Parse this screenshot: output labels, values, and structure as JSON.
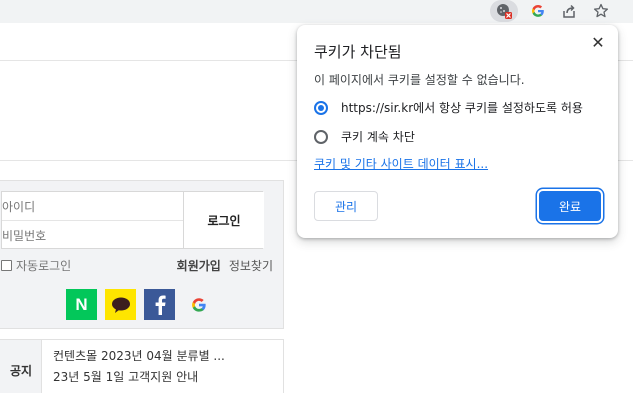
{
  "toolbar": {
    "icons": [
      "cookie-blocked-icon",
      "google-icon",
      "share-icon",
      "star-icon"
    ]
  },
  "login": {
    "id_placeholder": "아이디",
    "pw_placeholder": "비밀번호",
    "login_label": "로그인",
    "auto_login_label": "자동로그인",
    "join_label": "회원가입",
    "find_label": "정보찾기",
    "social": {
      "naver_label": "N",
      "colors": {
        "naver": "#03c75a",
        "kakao": "#fee500",
        "facebook": "#3b5998"
      }
    }
  },
  "notice": {
    "label": "공지",
    "items": [
      "컨텐츠몰 2023년 04월 분류별 ...",
      "23년 5월 1일 고객지원 안내"
    ]
  },
  "cookie_bubble": {
    "title": "쿠키가 차단됨",
    "description": "이 페이지에서 쿠키를 설정할 수 없습니다.",
    "options": [
      {
        "label": "https://sir.kr에서 항상 쿠키를 설정하도록 허용",
        "checked": true
      },
      {
        "label": "쿠키 계속 차단",
        "checked": false
      }
    ],
    "link_label": "쿠키 및 기타 사이트 데이터 표시...",
    "manage_label": "관리",
    "done_label": "완료",
    "accent_color": "#1a73e8"
  }
}
